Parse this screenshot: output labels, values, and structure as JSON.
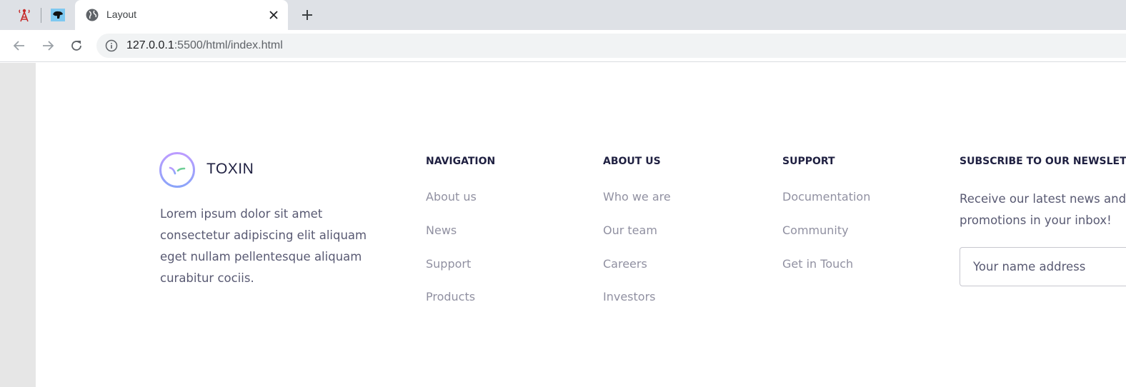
{
  "browser": {
    "pinned_tabs": [
      {
        "icon": "tower-icon"
      },
      {
        "icon": "panther-icon"
      }
    ],
    "active_tab": {
      "title": "Layout",
      "icon": "globe-icon"
    },
    "url_host": "127.0.0.1",
    "url_rest": ":5500/html/index.html"
  },
  "footer": {
    "brand": "TOXIN",
    "about": "Lorem ipsum dolor sit amet consectetur adipiscing elit aliquam eget nullam pellentesque aliquam curabitur cociis.",
    "columns": [
      {
        "heading": "NAVIGATION",
        "links": [
          "About us",
          "News",
          "Support",
          "Products"
        ]
      },
      {
        "heading": "ABOUT US",
        "links": [
          "Who we are",
          "Our team",
          "Careers",
          "Investors"
        ]
      },
      {
        "heading": "SUPPORT",
        "links": [
          "Documentation",
          "Community",
          "Get in Touch"
        ]
      }
    ],
    "subscribe": {
      "heading": "SUBSCRIBE TO OUR NEWSLETTER",
      "text_line1": "Receive our latest news and",
      "text_line2": "promotions in your inbox!",
      "placeholder": "Your name address"
    }
  },
  "colors": {
    "dark": "#1f2041",
    "gradient_start": "#BC9CFF",
    "gradient_end": "#8BA4F9",
    "accent_green": "#6FCF97"
  }
}
